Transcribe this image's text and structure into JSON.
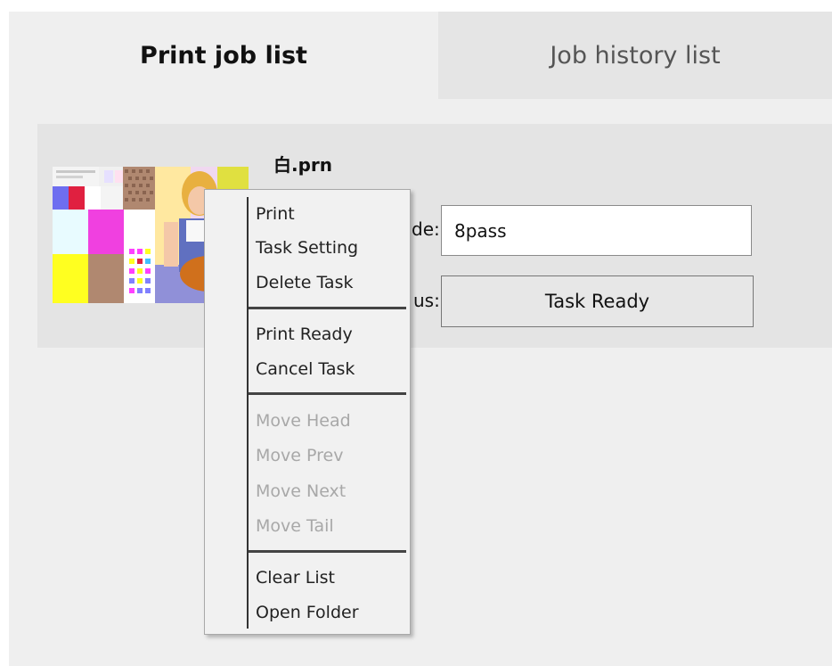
{
  "tabs": {
    "active": "Print job list",
    "inactive": "Job history list"
  },
  "job": {
    "file_name": "白.prn",
    "mode_label_partial": "de:",
    "mode_value": "8pass",
    "status_label_partial": "us:",
    "status_value": "Task Ready"
  },
  "context_menu": {
    "print": "Print",
    "task_setting": "Task Setting",
    "delete_task": "Delete Task",
    "print_ready": "Print Ready",
    "cancel_task": "Cancel Task",
    "move_head": "Move Head",
    "move_prev": "Move Prev",
    "move_next": "Move Next",
    "move_tail": "Move Tail",
    "clear_list": "Clear List",
    "open_folder": "Open Folder"
  },
  "colors": {
    "window_bg": "#efefef",
    "inactive_tab_bg": "#e5e5e5",
    "card_bg": "#e4e4e4",
    "menu_bg": "#f1f1f1",
    "disabled_text": "#a8a8a8"
  }
}
